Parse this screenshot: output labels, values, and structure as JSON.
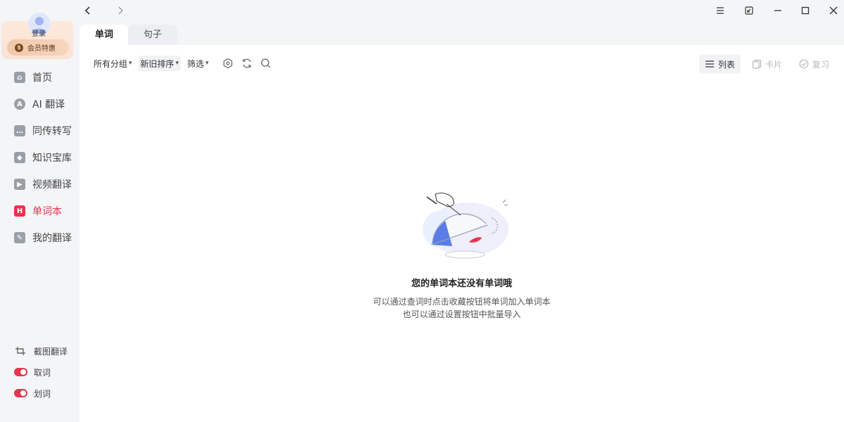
{
  "sidebar": {
    "login_label": "登录",
    "vip_label": "会员特惠",
    "nav": [
      {
        "label": "首页",
        "icon": "home-icon"
      },
      {
        "label": "AI 翻译",
        "icon": "ai-translate-icon"
      },
      {
        "label": "同传转写",
        "icon": "transcribe-icon"
      },
      {
        "label": "知识宝库",
        "icon": "knowledge-icon"
      },
      {
        "label": "视频翻译",
        "icon": "video-icon"
      },
      {
        "label": "单词本",
        "icon": "wordbook-icon"
      },
      {
        "label": "我的翻译",
        "icon": "my-translation-icon"
      }
    ],
    "active_nav": "单词本",
    "tools": [
      {
        "label": "截图翻译",
        "icon": "crop-icon"
      },
      {
        "label": "取词",
        "icon": "toggle-on-icon"
      },
      {
        "label": "划词",
        "icon": "toggle-on-icon"
      }
    ]
  },
  "tabs": [
    {
      "label": "单词",
      "active": true
    },
    {
      "label": "句子",
      "active": false
    }
  ],
  "toolbar": {
    "group_filter": "所有分组",
    "sort": "新旧排序",
    "filter": "筛选",
    "views": [
      {
        "label": "列表",
        "icon": "list-icon",
        "active": true
      },
      {
        "label": "卡片",
        "icon": "card-icon",
        "active": false
      },
      {
        "label": "复习",
        "icon": "check-circle-icon",
        "active": false
      }
    ]
  },
  "empty_state": {
    "title": "您的单词本还没有单词哦",
    "line1": "可以通过查词时点击收藏按钮将单词加入单词本",
    "line2": "也可以通过设置按钮中批量导入"
  },
  "colors": {
    "accent": "#e8344e",
    "sidebar_bg": "#f4f5f7",
    "panel_bg": "#ffffff"
  }
}
